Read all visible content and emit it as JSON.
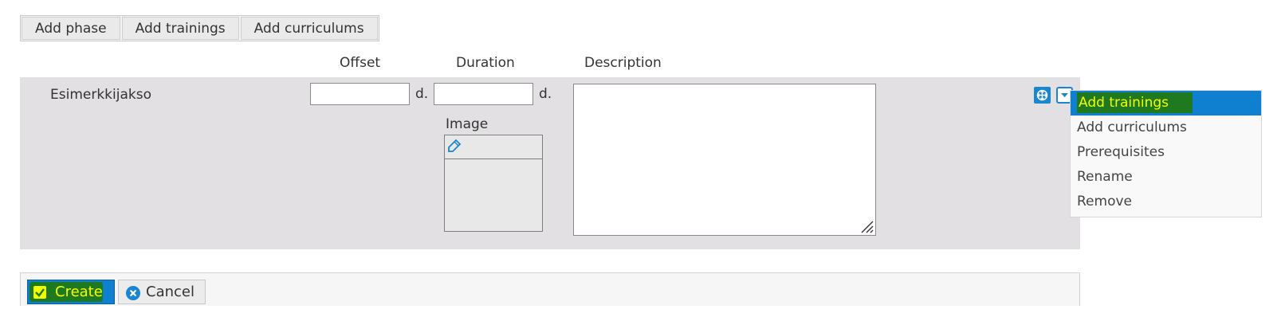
{
  "toolbar": {
    "buttons": [
      {
        "label": "Add phase"
      },
      {
        "label": "Add trainings"
      },
      {
        "label": "Add curriculums"
      }
    ]
  },
  "columns": {
    "offset": "Offset",
    "duration": "Duration",
    "description": "Description"
  },
  "phase": {
    "name": "Esimerkkijakso",
    "offset_value": "",
    "duration_value": "",
    "offset_unit": "d.",
    "duration_unit": "d.",
    "image_label": "Image",
    "description_value": ""
  },
  "context_menu": {
    "items": [
      {
        "label": "Add trainings",
        "active": true
      },
      {
        "label": "Add curriculums",
        "active": false
      },
      {
        "label": "Prerequisites",
        "active": false
      },
      {
        "label": "Rename",
        "active": false
      },
      {
        "label": "Remove",
        "active": false
      }
    ]
  },
  "footer": {
    "create_label": "Create",
    "cancel_label": "Cancel"
  },
  "colors": {
    "accent": "#0f7fcf",
    "highlight_text": "#f4ff00",
    "highlight_bg": "#1f7a1f",
    "row_bg": "#e2e0e2"
  },
  "icons": {
    "move": "move-icon",
    "dropdown": "chevron-down-icon",
    "image_edit": "edit-pencil-icon",
    "resize": "resize-handle-icon",
    "create": "check-icon",
    "cancel": "close-icon"
  }
}
